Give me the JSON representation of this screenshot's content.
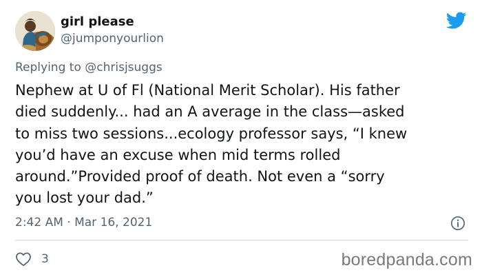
{
  "author": {
    "display_name": "girl please",
    "handle": "@jumponyourlion",
    "avatar_icon": "avatar-person-with-lion"
  },
  "reply_context": {
    "prefix": "Replying to",
    "mention": "@chrisjsuggs"
  },
  "tweet": {
    "lines": [
      "Nephew at U of Fl (National Merit Scholar). His father",
      "died suddenly... had an A average in the class—asked",
      "to miss two sessions...ecology professor says, “I knew",
      "you’d have an excuse when mid terms rolled",
      "around.”Provided proof of death. Not even a “sorry",
      "you lost your dad.”"
    ],
    "timestamp": "2:42 AM · Mar 16, 2021"
  },
  "actions": {
    "like_count": "3",
    "like_icon": "heart-icon",
    "info_icon": "info-icon"
  },
  "brand": {
    "twitter_icon": "twitter-bird-icon",
    "twitter_color": "#1d9bf0",
    "watermark": "boredpanda.com"
  },
  "colors": {
    "text": "#0f1419",
    "secondary": "#536471",
    "divider": "#cfd9de"
  }
}
